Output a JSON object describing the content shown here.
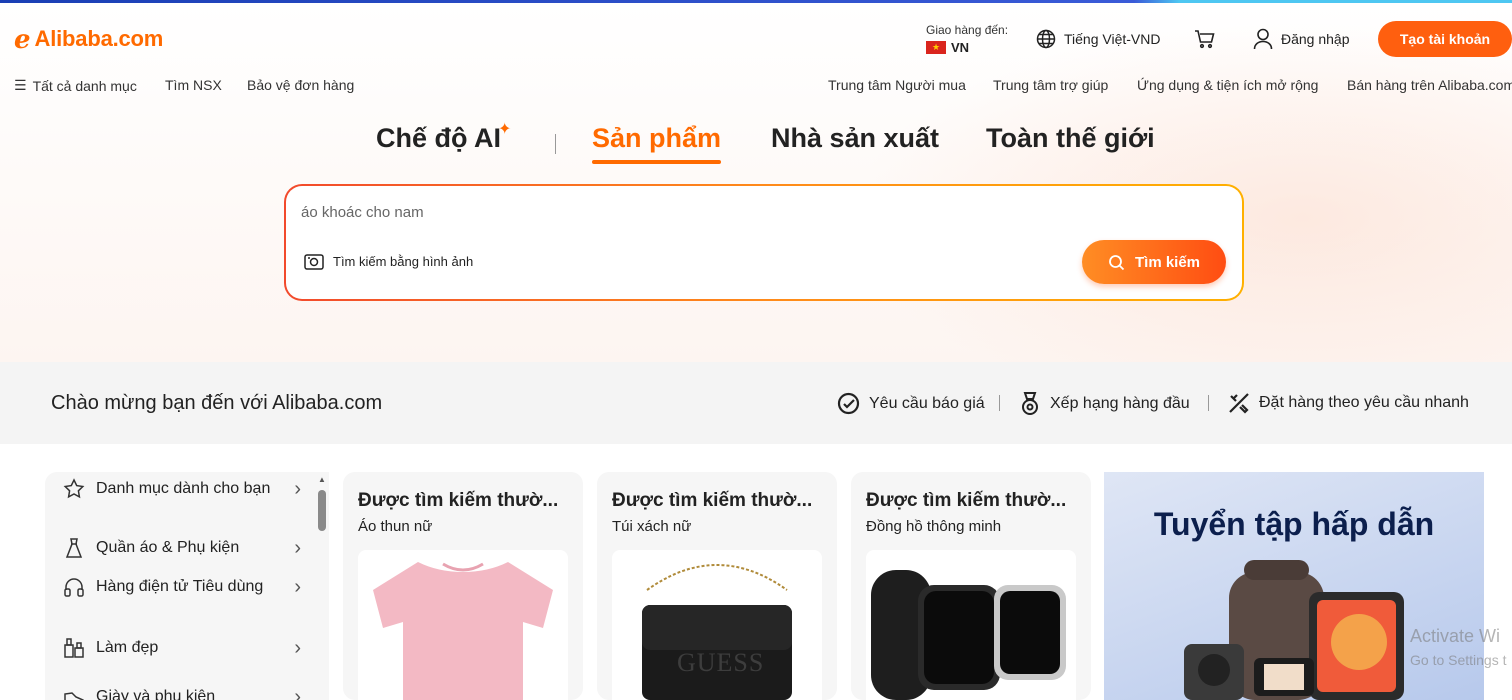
{
  "header": {
    "logo_mark": "ℯ",
    "logo_text": "Alibaba.com",
    "deliver_label": "Giao hàng đến:",
    "deliver_country": "VN",
    "language": "Tiếng Việt-VND",
    "sign_in": "Đăng nhập",
    "create_account": "Tạo tài khoản"
  },
  "nav": {
    "all_categories": "Tất cả danh mục",
    "find_suppliers": "Tìm NSX",
    "order_protection": "Bảo vệ đơn hàng",
    "buyer_center": "Trung tâm Người mua",
    "help_center": "Trung tâm trợ giúp",
    "apps": "Ứng dụng & tiện ích mở rộng",
    "sell": "Bán hàng trên Alibaba.com"
  },
  "tabs": {
    "ai_mode": "Chế độ AI",
    "products": "Sản phẩm",
    "manufacturers": "Nhà sản xuất",
    "worldwide": "Toàn thế giới"
  },
  "search": {
    "placeholder": "áo khoác cho nam",
    "image_search": "Tìm kiếm bằng hình ảnh",
    "button": "Tìm kiếm"
  },
  "welcome": {
    "title": "Chào mừng bạn đến với Alibaba.com",
    "rfq": "Yêu cầu báo giá",
    "top_ranking": "Xếp hạng hàng đầu",
    "fast_customization": "Đặt hàng theo yêu cầu nhanh"
  },
  "categories": [
    {
      "label": "Danh mục dành cho bạn"
    },
    {
      "label": "Quần áo & Phụ kiện"
    },
    {
      "label": "Hàng điện tử Tiêu dùng"
    },
    {
      "label": "Làm đẹp"
    },
    {
      "label": "Giày và phụ kiện"
    }
  ],
  "cards": [
    {
      "title": "Được tìm kiếm thườ...",
      "subtitle": "Áo thun nữ"
    },
    {
      "title": "Được tìm kiếm thườ...",
      "subtitle": "Túi xách nữ"
    },
    {
      "title": "Được tìm kiếm thườ...",
      "subtitle": "Đồng hồ thông minh"
    }
  ],
  "promo": {
    "title": "Tuyển tập hấp dẫn"
  },
  "bag_brand": "GUESS",
  "watermark": {
    "line1": "Activate Wi",
    "line2": "Go to Settings t"
  },
  "colors": {
    "brand": "#ff6a00",
    "button": "#ff5f0f"
  }
}
